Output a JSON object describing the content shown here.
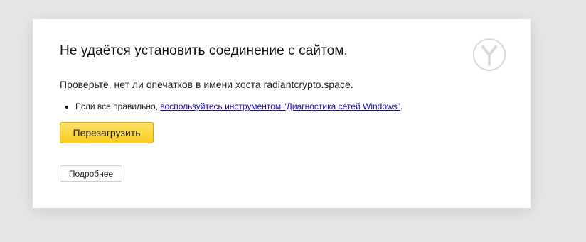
{
  "error": {
    "title": "Не удаётся установить соединение с сайтом.",
    "check_text": "Проверьте, нет ли опечатков в имени хоста radiantcrypto.space.",
    "bullet_prefix": "Если все правильно, ",
    "bullet_link": "воспользуйтесь инструментом \"Диагностика сетей Windows\"",
    "bullet_suffix": "."
  },
  "buttons": {
    "reload_label": "Перезагрузить",
    "details_label": "Подробнее"
  },
  "icons": {
    "browser_logo": "yandex-browser-logo-icon"
  },
  "colors": {
    "page_background": "#e6e6e6",
    "card_background": "#ffffff",
    "reload_button": "#fbd43b",
    "link": "#1a0dab",
    "logo_outline": "#dadada"
  }
}
